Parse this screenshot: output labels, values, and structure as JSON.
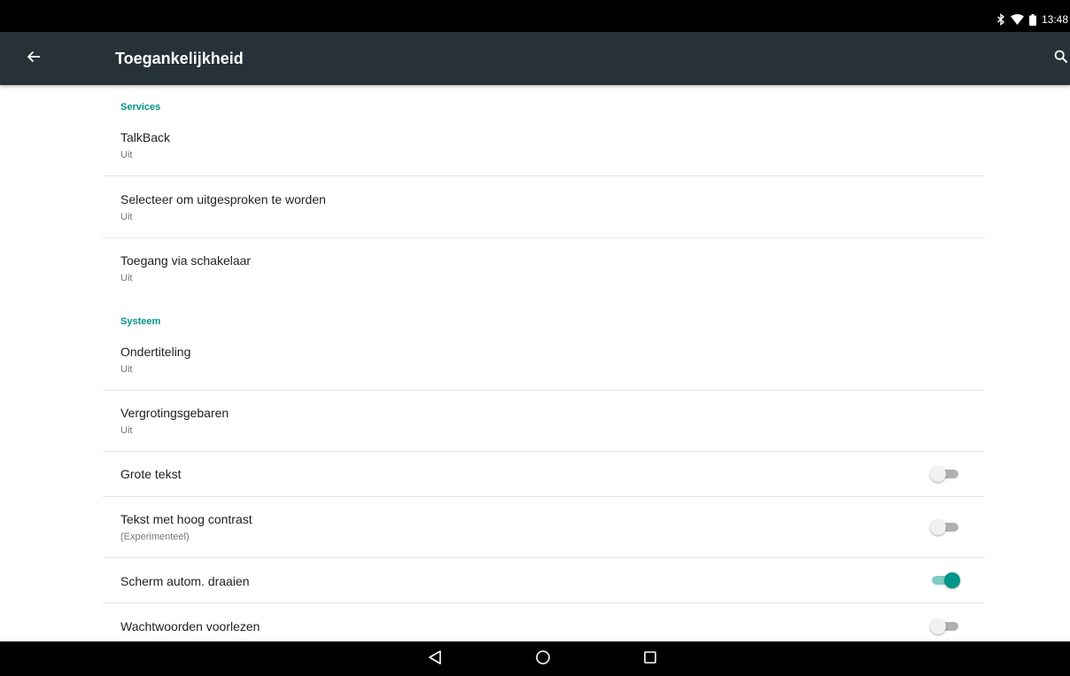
{
  "status_bar": {
    "time": "13:48",
    "icons": [
      "bluetooth-icon",
      "wifi-icon",
      "battery-icon"
    ]
  },
  "action_bar": {
    "title": "Toegankelijkheid",
    "back_icon": "arrow-back-icon",
    "search_icon": "search-icon"
  },
  "sections": {
    "services": {
      "header": "Services",
      "items": [
        {
          "title": "TalkBack",
          "summary": "Uit"
        },
        {
          "title": "Selecteer om uitgesproken te worden",
          "summary": "Uit"
        },
        {
          "title": "Toegang via schakelaar",
          "summary": "Uit"
        }
      ]
    },
    "systeem": {
      "header": "Systeem",
      "items": [
        {
          "title": "Ondertiteling",
          "summary": "Uit"
        },
        {
          "title": "Vergrotingsgebaren",
          "summary": "Uit"
        },
        {
          "title": "Grote tekst",
          "switch_on": false
        },
        {
          "title": "Tekst met hoog contrast",
          "summary": "(Experimenteel)",
          "switch_on": false
        },
        {
          "title": "Scherm autom. draaien",
          "switch_on": true
        },
        {
          "title": "Wachtwoorden voorlezen",
          "switch_on": false
        }
      ]
    }
  },
  "colors": {
    "accent": "#009688",
    "action_bar": "#263238",
    "switch_track_on": "#80cbc4",
    "switch_track_off": "#b0b0b0"
  },
  "navigation_bar": {
    "icons": [
      "back-triangle-icon",
      "home-circle-icon",
      "recents-square-icon"
    ]
  }
}
